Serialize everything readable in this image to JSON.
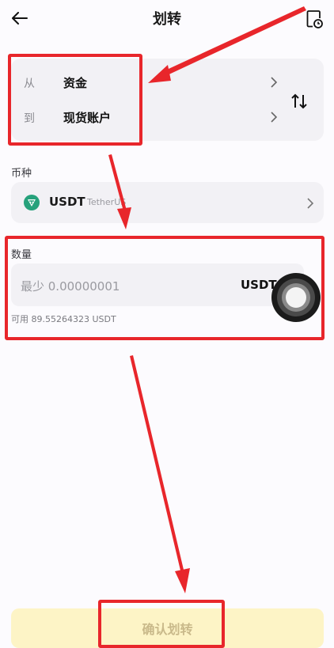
{
  "header": {
    "title": "划转",
    "back_icon": "arrow-left-icon",
    "history_icon": "document-clock-icon"
  },
  "transfer": {
    "from_label": "从",
    "from_value": "资金",
    "to_label": "到",
    "to_value": "现货账户",
    "chevron_icon": "chevron-right-icon",
    "swap_icon": "swap-vertical-icon"
  },
  "currency": {
    "section_label": "币种",
    "code": "USDT",
    "name": "TetherUS",
    "icon": "tether-icon",
    "icon_color": "#26a17b"
  },
  "amount": {
    "section_label": "数量",
    "placeholder": "最少 0.00000001",
    "unit": "USDT",
    "available": "可用 89.55264323 USDT"
  },
  "confirm_button": {
    "label": "确认划转"
  },
  "colors": {
    "highlight": "#e8262b",
    "button_bg": "#fdf4c6",
    "button_text": "#c9b98a"
  }
}
